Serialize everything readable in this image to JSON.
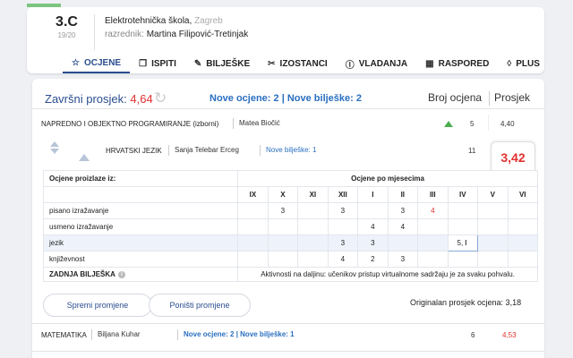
{
  "header": {
    "class_name": "3.C",
    "school_year": "19/20",
    "school": "Elektrotehnička škola",
    "city": "Zagreb",
    "teacher_label": "razrednik:",
    "teacher": "Martina Filipović-Tretinjak"
  },
  "tabs": [
    {
      "label": "OCJENE",
      "icon": "star-icon",
      "glyph": "☆"
    },
    {
      "label": "ISPITI",
      "icon": "copy-icon",
      "glyph": "❐"
    },
    {
      "label": "BILJEŠKE",
      "icon": "pencil-icon",
      "glyph": "✎"
    },
    {
      "label": "IZOSTANCI",
      "icon": "scissors-icon",
      "glyph": "✂"
    },
    {
      "label": "VLADANJA",
      "icon": "info-icon",
      "glyph": "ⓘ"
    },
    {
      "label": "RASPORED",
      "icon": "calendar-icon",
      "glyph": "▦"
    },
    {
      "label": "PLUS",
      "icon": "diamond-icon",
      "glyph": "◊"
    }
  ],
  "summary": {
    "label": "Završni prosjek:",
    "value": "4,64",
    "new_grades": "Nove ocjene: 2",
    "divider": "|",
    "new_notes": "Nove bilješke: 2",
    "col_count": "Broj ocjena",
    "col_avg": "Prosjek"
  },
  "subjects": [
    {
      "name": "NAPREDNO I OBJEKTNO PROGRAMIRANJE (izborni)",
      "teacher": "Matea Biočić",
      "count": "5",
      "avg": "4,40"
    },
    {
      "name": "HRVATSKI JEZIK",
      "teacher": "Sanja Telebar Erceg",
      "new_notes": "Nove bilješke: 1",
      "count": "11",
      "avg": "3,42"
    },
    {
      "name": "MATEMATIKA",
      "teacher": "Biljana Kuhar",
      "new_info": "Nove ocjene: 2 | Nove bilješke: 1",
      "count": "6",
      "avg": "4,53"
    }
  ],
  "grades_table": {
    "source_label": "Ocjene proizlaze iz:",
    "months_label": "Ocjene po mjesecima",
    "months": [
      "IX",
      "X",
      "XI",
      "XII",
      "I",
      "II",
      "III",
      "IV",
      "V",
      "VI"
    ],
    "rows": [
      {
        "category": "pisano izražavanje",
        "grades": [
          "",
          "3",
          "",
          "3",
          "",
          "3",
          "4",
          "",
          "",
          ""
        ]
      },
      {
        "category": "usmeno izražavanje",
        "grades": [
          "",
          "",
          "",
          "",
          "4",
          "4",
          "",
          "",
          "",
          ""
        ]
      },
      {
        "category": "jezik",
        "grades": [
          "",
          "",
          "",
          "3",
          "3",
          "",
          "",
          "5,",
          "",
          ""
        ]
      },
      {
        "category": "književnost",
        "grades": [
          "",
          "",
          "",
          "4",
          "2",
          "3",
          "",
          "",
          "",
          ""
        ]
      }
    ],
    "last_note_label": "ZADNJA BILJEŠKA",
    "last_note": "Aktivnosti na daljinu: učenikov pristup virtualnome sadržaju je za svaku pohvalu."
  },
  "actions": {
    "save": "Spremi promjene",
    "cancel": "Poništi promjene",
    "original_avg": "Originalan prosjek ocjena: 3,18"
  },
  "colors": {
    "accent": "#2a4d8f",
    "link": "#2a6fc0",
    "red": "#e0312f",
    "up": "#4caf50"
  }
}
